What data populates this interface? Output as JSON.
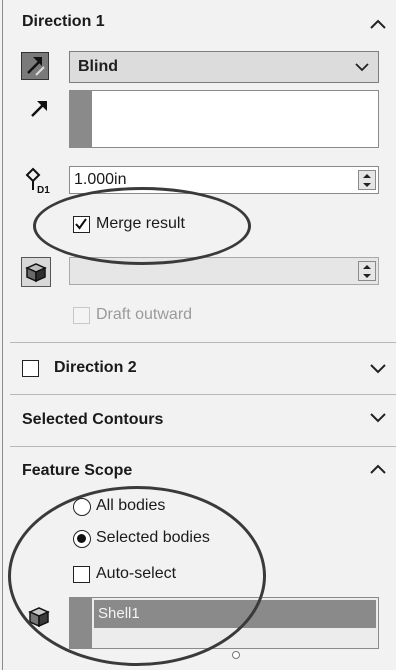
{
  "direction1": {
    "title": "Direction 1",
    "end_condition": "Blind",
    "depth_value": "1.000in",
    "merge_result": {
      "label": "Merge result",
      "checked": true
    },
    "draft_outward": {
      "label": "Draft outward",
      "checked": false
    }
  },
  "direction2": {
    "title": "Direction 2",
    "checked": false
  },
  "selected_contours": {
    "title": "Selected Contours"
  },
  "feature_scope": {
    "title": "Feature Scope",
    "options": [
      {
        "label": "All bodies",
        "selected": false
      },
      {
        "label": "Selected bodies",
        "selected": true
      }
    ],
    "auto_select": {
      "label": "Auto-select",
      "checked": false
    },
    "bodies": [
      "Shell1"
    ]
  }
}
